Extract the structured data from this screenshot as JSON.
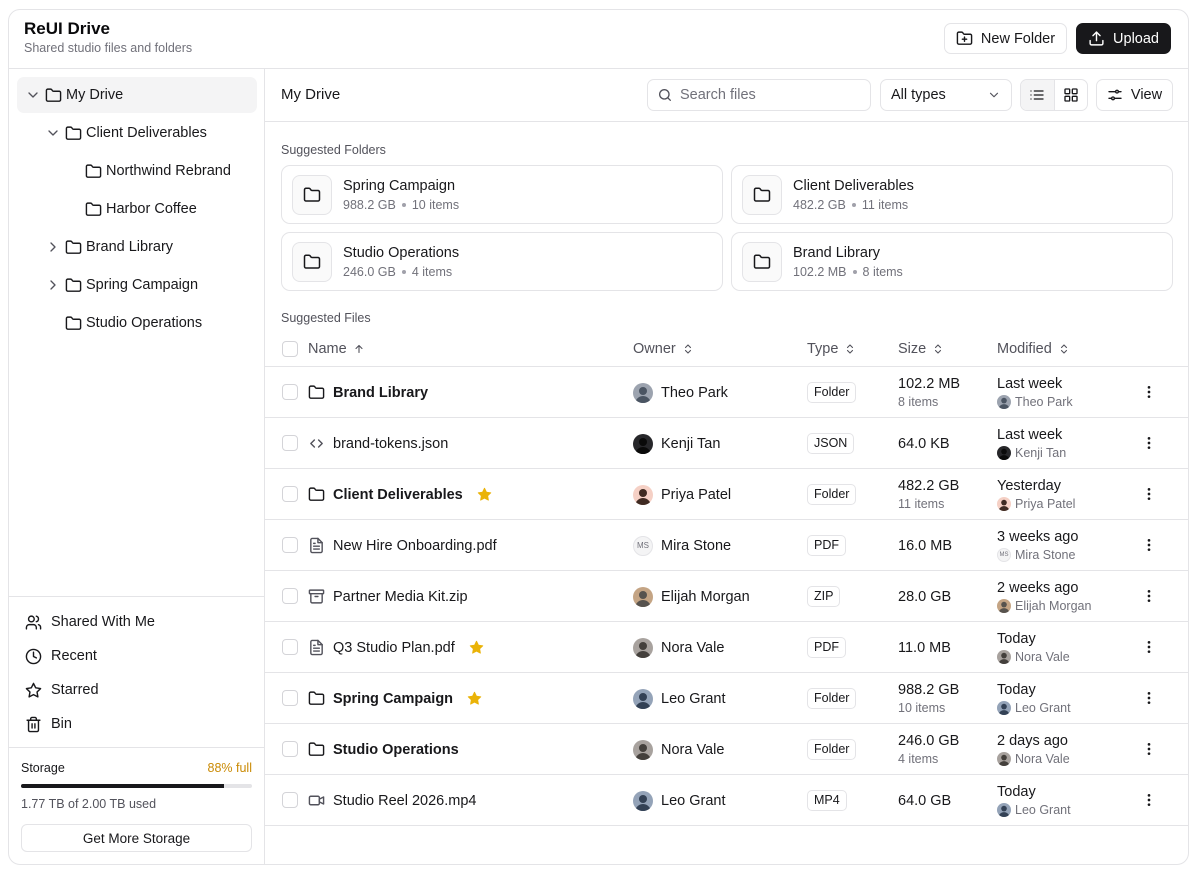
{
  "app": {
    "title": "ReUI Drive",
    "subtitle": "Shared studio files and folders"
  },
  "header": {
    "new_folder_label": "New Folder",
    "upload_label": "Upload"
  },
  "sidebar": {
    "tree": [
      {
        "label": "My Drive",
        "level": 0,
        "chevron": "down",
        "active": true
      },
      {
        "label": "Client Deliverables",
        "level": 1,
        "chevron": "down"
      },
      {
        "label": "Northwind Rebrand",
        "level": 2,
        "chevron": "none"
      },
      {
        "label": "Harbor Coffee",
        "level": 2,
        "chevron": "none"
      },
      {
        "label": "Brand Library",
        "level": 1,
        "chevron": "right"
      },
      {
        "label": "Spring Campaign",
        "level": 1,
        "chevron": "right"
      },
      {
        "label": "Studio Operations",
        "level": 1,
        "chevron": "none"
      }
    ],
    "nav": [
      {
        "label": "Shared With Me",
        "icon": "users-icon"
      },
      {
        "label": "Recent",
        "icon": "clock-icon"
      },
      {
        "label": "Starred",
        "icon": "star-icon"
      },
      {
        "label": "Bin",
        "icon": "trash-icon"
      }
    ],
    "storage": {
      "label": "Storage",
      "percent_label": "88% full",
      "fraction": 0.88,
      "used_label": "1.77 TB of 2.00 TB used",
      "button_label": "Get More Storage"
    }
  },
  "toolbar": {
    "breadcrumb": "My Drive",
    "search_placeholder": "Search files",
    "type_filter": "All types",
    "view_label": "View"
  },
  "suggested_folders": {
    "label": "Suggested Folders",
    "items": [
      {
        "name": "Spring Campaign",
        "size": "988.2 GB",
        "count": "10 items"
      },
      {
        "name": "Client Deliverables",
        "size": "482.2 GB",
        "count": "11 items"
      },
      {
        "name": "Studio Operations",
        "size": "246.0 GB",
        "count": "4 items"
      },
      {
        "name": "Brand Library",
        "size": "102.2 MB",
        "count": "8 items"
      }
    ]
  },
  "suggested_files": {
    "label": "Suggested Files",
    "columns": {
      "name": "Name",
      "owner": "Owner",
      "type": "Type",
      "size": "Size",
      "modified": "Modified"
    },
    "rows": [
      {
        "name": "Brand Library",
        "icon": "folder-icon",
        "bold": true,
        "starred": false,
        "owner": "Theo Park",
        "type": "Folder",
        "size": "102.2 MB",
        "sub": "8 items",
        "modified": "Last week",
        "by": "Theo Park"
      },
      {
        "name": "brand-tokens.json",
        "icon": "code-icon",
        "bold": false,
        "starred": false,
        "owner": "Kenji Tan",
        "type": "JSON",
        "size": "64.0 KB",
        "sub": "",
        "modified": "Last week",
        "by": "Kenji Tan"
      },
      {
        "name": "Client Deliverables",
        "icon": "folder-icon",
        "bold": true,
        "starred": true,
        "owner": "Priya Patel",
        "type": "Folder",
        "size": "482.2 GB",
        "sub": "11 items",
        "modified": "Yesterday",
        "by": "Priya Patel"
      },
      {
        "name": "New Hire Onboarding.pdf",
        "icon": "file-text-icon",
        "bold": false,
        "starred": false,
        "owner": "Mira Stone",
        "owner_initials": "MS",
        "type": "PDF",
        "size": "16.0 MB",
        "sub": "",
        "modified": "3 weeks ago",
        "by": "Mira Stone"
      },
      {
        "name": "Partner Media Kit.zip",
        "icon": "archive-icon",
        "bold": false,
        "starred": false,
        "owner": "Elijah Morgan",
        "type": "ZIP",
        "size": "28.0 GB",
        "sub": "",
        "modified": "2 weeks ago",
        "by": "Elijah Morgan"
      },
      {
        "name": "Q3 Studio Plan.pdf",
        "icon": "file-text-icon",
        "bold": false,
        "starred": true,
        "owner": "Nora Vale",
        "type": "PDF",
        "size": "11.0 MB",
        "sub": "",
        "modified": "Today",
        "by": "Nora Vale"
      },
      {
        "name": "Spring Campaign",
        "icon": "folder-icon",
        "bold": true,
        "starred": true,
        "owner": "Leo Grant",
        "type": "Folder",
        "size": "988.2 GB",
        "sub": "10 items",
        "modified": "Today",
        "by": "Leo Grant"
      },
      {
        "name": "Studio Operations",
        "icon": "folder-icon",
        "bold": true,
        "starred": false,
        "owner": "Nora Vale",
        "type": "Folder",
        "size": "246.0 GB",
        "sub": "4 items",
        "modified": "2 days ago",
        "by": "Nora Vale"
      },
      {
        "name": "Studio Reel 2026.mp4",
        "icon": "video-icon",
        "bold": false,
        "starred": false,
        "owner": "Leo Grant",
        "type": "MP4",
        "size": "64.0 GB",
        "sub": "",
        "modified": "Today",
        "by": "Leo Grant"
      }
    ]
  },
  "colors": {
    "accent_dark": "#18181b",
    "star": "#eab308",
    "storage_warning": "#ca8a04",
    "border": "#e4e4e7"
  }
}
